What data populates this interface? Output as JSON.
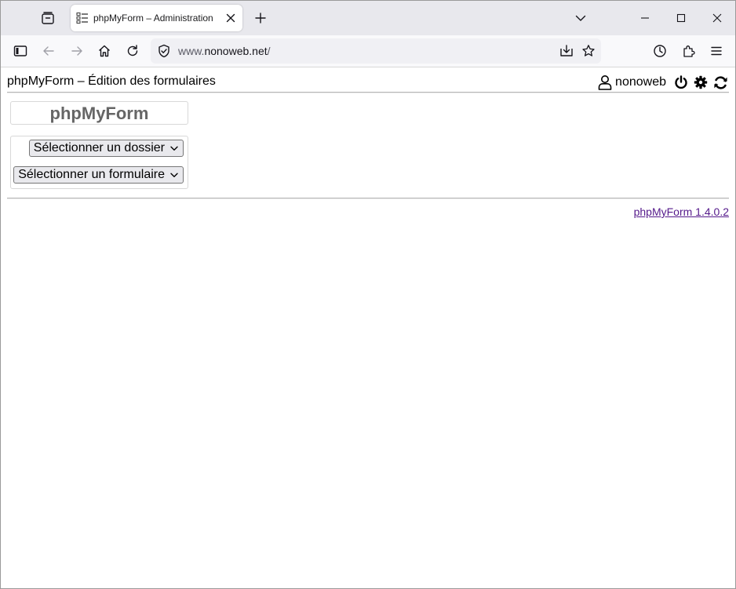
{
  "browser": {
    "tab": {
      "title": "phpMyForm – Administration"
    },
    "url": {
      "prefix": "www.",
      "host": "nonoweb.net",
      "path": "/"
    },
    "icons": {
      "tab_list": "tab-list-icon",
      "favicon": "form-list-icon",
      "close": "close-icon",
      "new_tab": "plus-icon",
      "overflow": "chevron-down-icon",
      "minimize": "minimize-icon",
      "maximize": "maximize-icon",
      "window_close": "close-icon",
      "sidebar": "sidebar-icon",
      "back": "arrow-left-icon",
      "forward": "arrow-right-icon",
      "home": "home-icon",
      "reload": "reload-icon",
      "shield": "shield-icon",
      "save_page": "download-icon",
      "bookmark": "star-icon",
      "history": "clock-icon",
      "extensions": "puzzle-icon",
      "menu": "hamburger-menu-icon"
    }
  },
  "app": {
    "title": "phpMyForm – Édition des formulaires",
    "user": {
      "name": "nonoweb"
    },
    "brand": "phpMyForm",
    "selects": {
      "folder": "Sélectionner un dossier",
      "form": "Sélectionner un formulaire"
    },
    "footer": {
      "version_link": "phpMyForm 1.4.0.2"
    }
  },
  "colors": {
    "tabstrip_bg": "#e8e8ed",
    "toolbar_bg": "#f9f9fb",
    "urlbar_bg": "#f0f0f4",
    "brand_text": "#666666",
    "visited_link": "#551a8b"
  }
}
